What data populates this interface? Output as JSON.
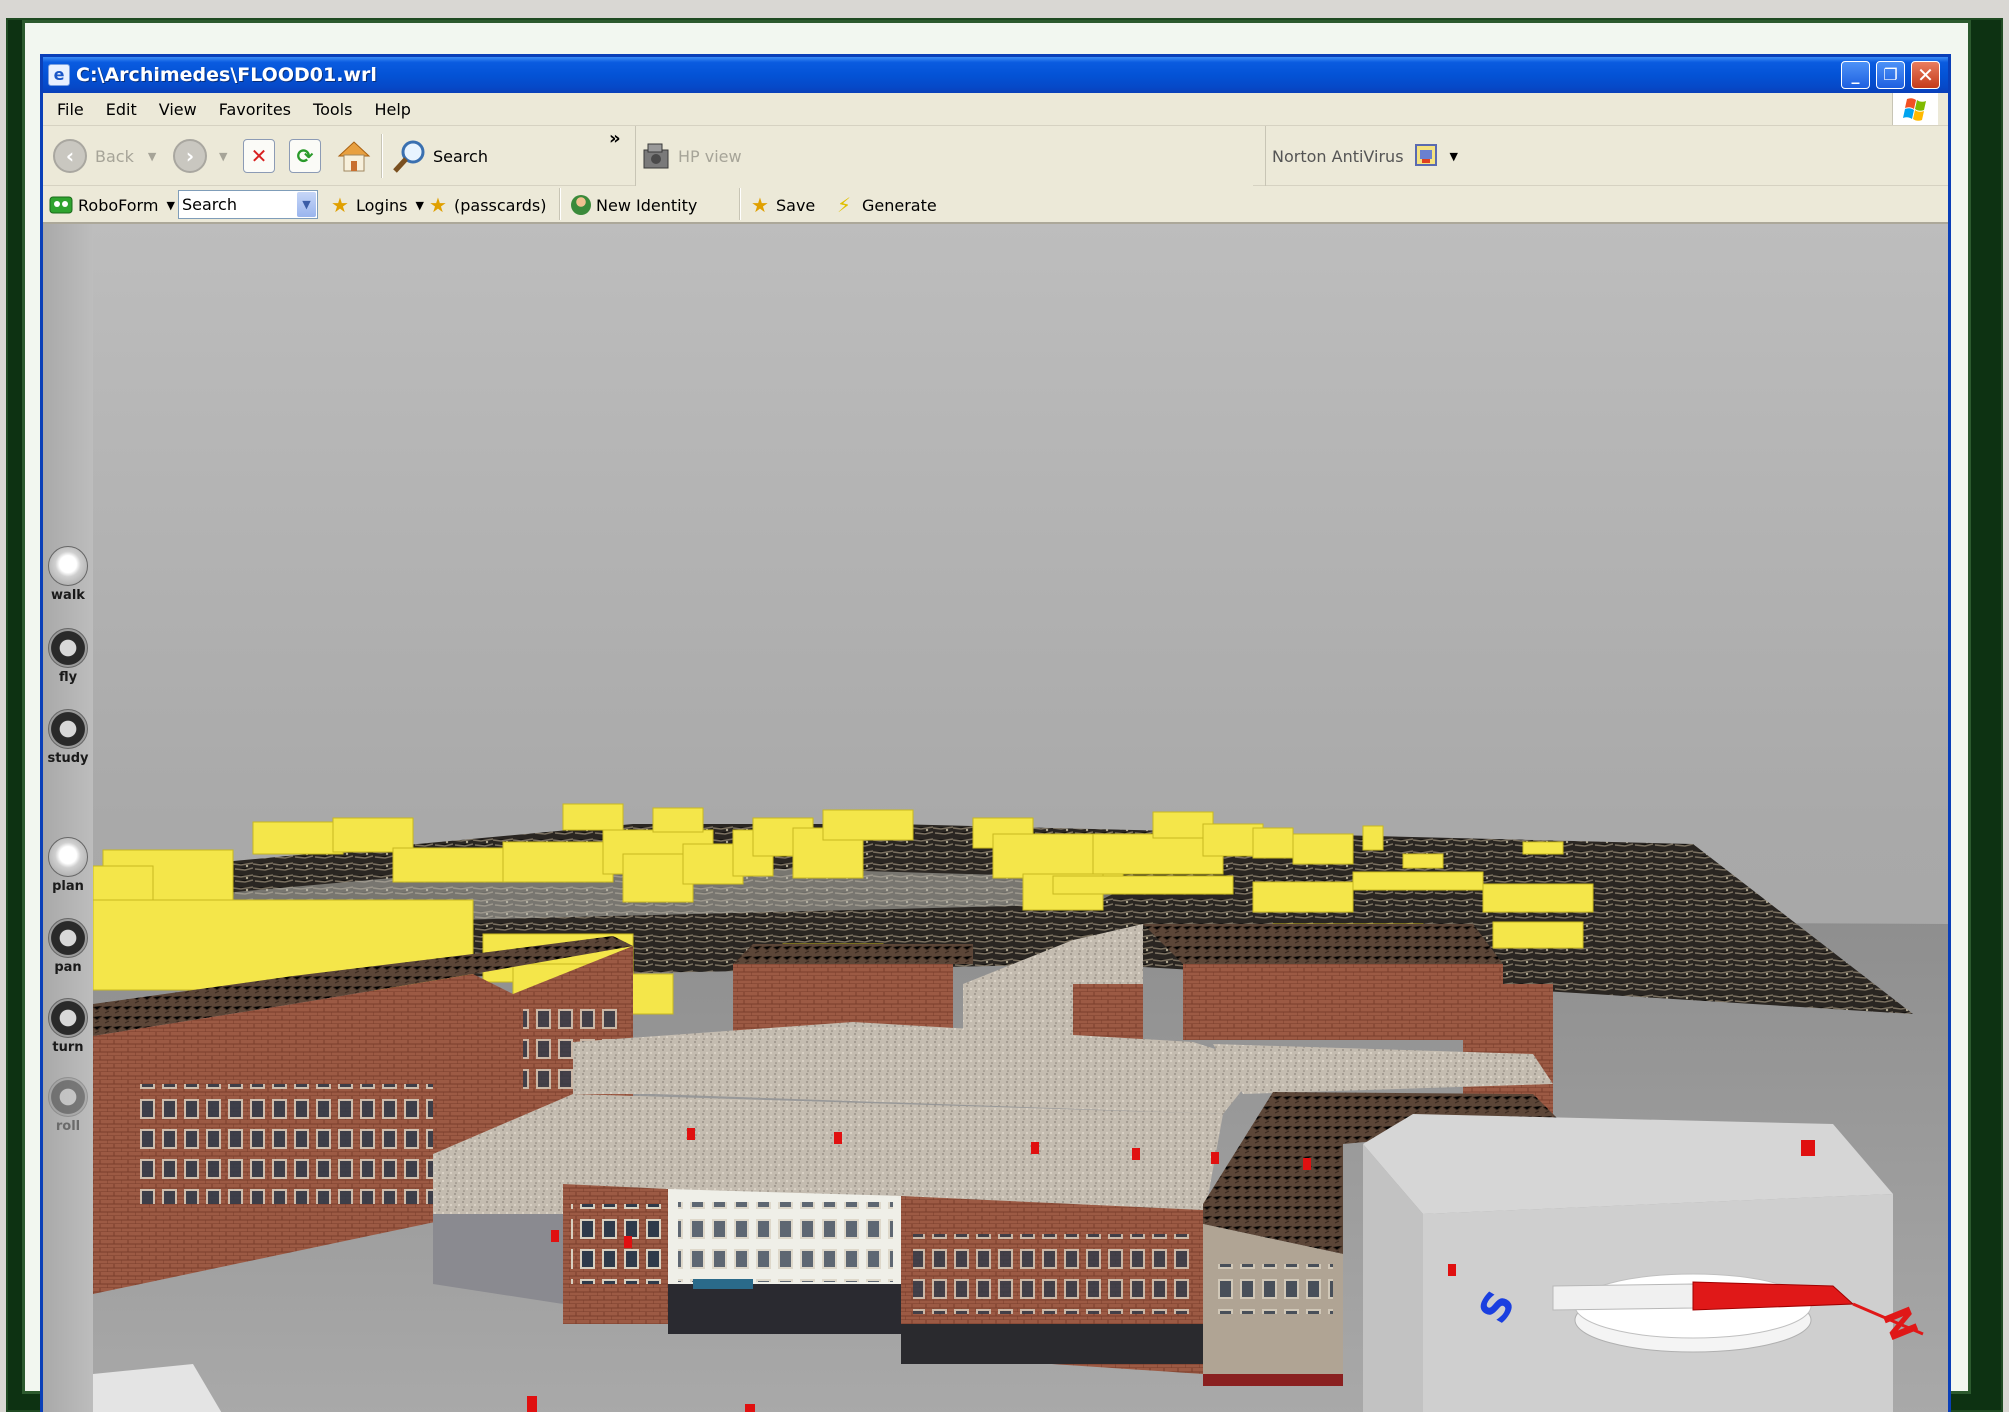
{
  "window": {
    "title": "C:\\Archimedes\\FLOOD01.wrl",
    "controls": [
      "minimize",
      "restore",
      "close"
    ]
  },
  "menu": [
    "File",
    "Edit",
    "View",
    "Favorites",
    "Tools",
    "Help"
  ],
  "toolbar": {
    "back_label": "Back",
    "search_label": "Search",
    "overflow_label": "»",
    "hp_view_label": "HP view",
    "norton_label": "Norton AntiVirus"
  },
  "roboform": {
    "brand_label": "RoboForm",
    "search_value": "Search",
    "logins_label": "Logins",
    "passcards_label": "(passcards)",
    "new_identity_label": "New Identity",
    "save_label": "Save",
    "generate_label": "Generate"
  },
  "navigation": [
    {
      "label": "walk",
      "state": "active"
    },
    {
      "label": "fly",
      "state": "normal"
    },
    {
      "label": "study",
      "state": "normal"
    },
    {
      "label": "plan",
      "state": "active"
    },
    {
      "label": "pan",
      "state": "normal"
    },
    {
      "label": "turn",
      "state": "normal"
    },
    {
      "label": "roll",
      "state": "disabled"
    }
  ],
  "compass": {
    "south_label": "S",
    "north_label": "N"
  },
  "colors": {
    "titlebar": "#0453d6",
    "frame": "#0d3212",
    "flood_buildings": "#f4e64a",
    "brick": "#9c5a44",
    "roof_gravel": "#c8c0b4",
    "marker": "#e01010",
    "compass_red": "#e01818",
    "compass_blue": "#1a3fe0"
  }
}
